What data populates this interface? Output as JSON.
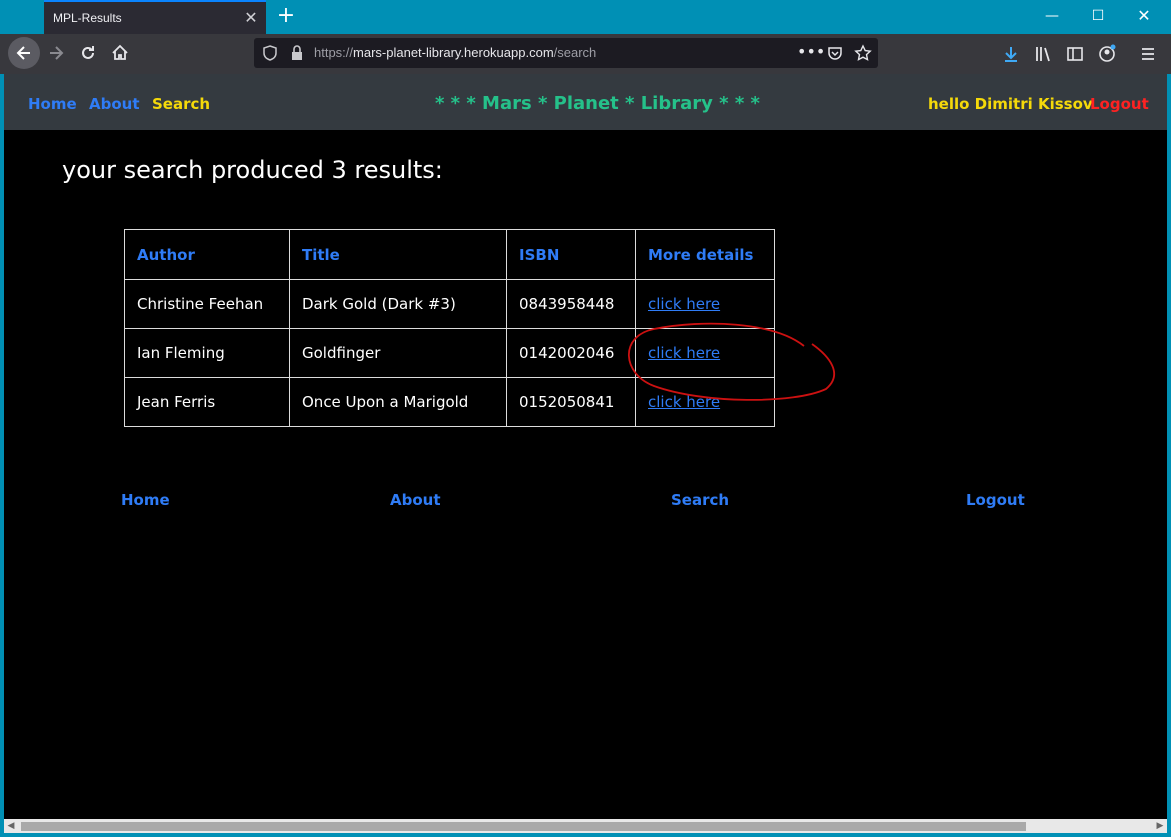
{
  "browser": {
    "tab_title": "MPL-Results",
    "url_prefix": "https://",
    "url_host": "mars-planet-library.herokuapp.com",
    "url_path": "/search"
  },
  "header": {
    "nav": [
      {
        "label": "Home",
        "color": "#2f7cf6"
      },
      {
        "label": "About",
        "color": "#2f7cf6"
      },
      {
        "label": "Search",
        "color": "#f5d90a"
      }
    ],
    "brand": "* * * Mars * Planet * Library * * *",
    "greeting": "hello Dimitri Kissov",
    "logout": "Logout"
  },
  "main": {
    "heading": "your search produced 3 results:",
    "table": {
      "columns": [
        "Author",
        "Title",
        "ISBN",
        "More details"
      ],
      "rows": [
        {
          "author": "Christine Feehan",
          "title": "Dark Gold (Dark #3)",
          "isbn": "0843958448",
          "link": "click here"
        },
        {
          "author": "Ian Fleming",
          "title": "Goldfinger",
          "isbn": "0142002046",
          "link": "click here"
        },
        {
          "author": "Jean Ferris",
          "title": "Once Upon a Marigold",
          "isbn": "0152050841",
          "link": "click here"
        }
      ]
    }
  },
  "footer": {
    "links": [
      "Home",
      "About",
      "Search",
      "Logout"
    ]
  },
  "colors": {
    "link_blue": "#2f7cf6",
    "brand_green": "#25c18a",
    "greeting_yellow": "#f5d90a",
    "logout_red": "#ff2222",
    "annotation_red": "#cc1111"
  }
}
